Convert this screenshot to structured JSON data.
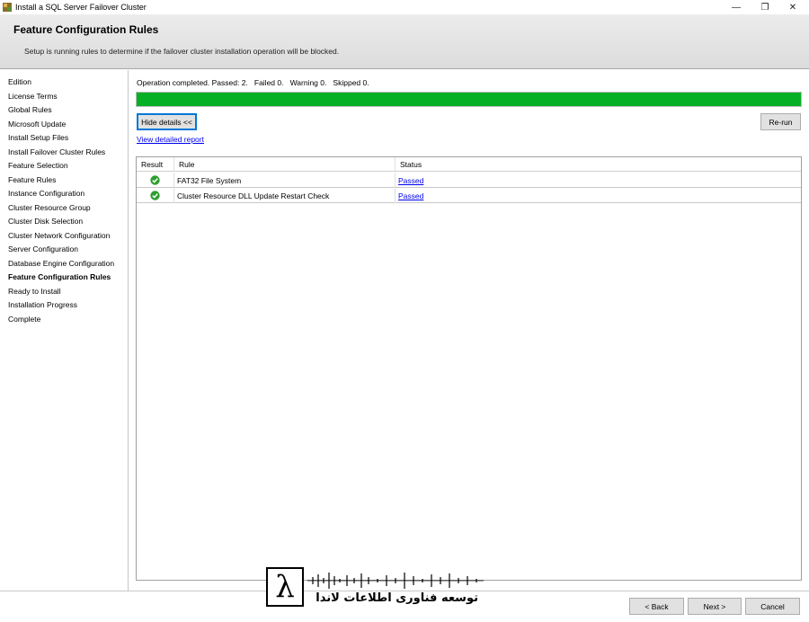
{
  "window": {
    "title": "Install a SQL Server Failover Cluster",
    "controls": {
      "minimize": "—",
      "maximize": "❐",
      "close": "✕"
    }
  },
  "header": {
    "title": "Feature Configuration Rules",
    "subtitle": "Setup is running rules to determine if the failover cluster installation operation will be blocked."
  },
  "sidebar": {
    "items": [
      {
        "label": "Edition",
        "active": false
      },
      {
        "label": "License Terms",
        "active": false
      },
      {
        "label": "Global Rules",
        "active": false
      },
      {
        "label": "Microsoft Update",
        "active": false
      },
      {
        "label": "Install Setup Files",
        "active": false
      },
      {
        "label": "Install Failover Cluster Rules",
        "active": false
      },
      {
        "label": "Feature Selection",
        "active": false
      },
      {
        "label": "Feature Rules",
        "active": false
      },
      {
        "label": "Instance Configuration",
        "active": false
      },
      {
        "label": "Cluster Resource Group",
        "active": false
      },
      {
        "label": "Cluster Disk Selection",
        "active": false
      },
      {
        "label": "Cluster Network Configuration",
        "active": false
      },
      {
        "label": "Server Configuration",
        "active": false
      },
      {
        "label": "Database Engine Configuration",
        "active": false
      },
      {
        "label": "Feature Configuration Rules",
        "active": true
      },
      {
        "label": "Ready to Install",
        "active": false
      },
      {
        "label": "Installation Progress",
        "active": false
      },
      {
        "label": "Complete",
        "active": false
      }
    ]
  },
  "main": {
    "operation_status": "Operation completed. Passed: 2.   Failed 0.   Warning 0.   Skipped 0.",
    "progress_percent": 100,
    "hide_details_label": "Hide details <<",
    "rerun_label": "Re-run",
    "view_report_label": "View detailed report",
    "table": {
      "columns": [
        "Result",
        "Rule",
        "Status"
      ],
      "rows": [
        {
          "result_icon": "passed-check-icon",
          "rule": "FAT32 File System",
          "status": "Passed"
        },
        {
          "result_icon": "passed-check-icon",
          "rule": "Cluster Resource DLL Update Restart Check",
          "status": "Passed"
        }
      ]
    }
  },
  "footer": {
    "back_label": "< Back",
    "next_label": "Next >",
    "cancel_label": "Cancel"
  },
  "watermark": {
    "symbol": "λ",
    "text": "توسعه فناوری اطلاعات لاندا"
  },
  "colors": {
    "progress": "#06b025",
    "link": "#0000ee",
    "check": "#2e9e2e"
  }
}
